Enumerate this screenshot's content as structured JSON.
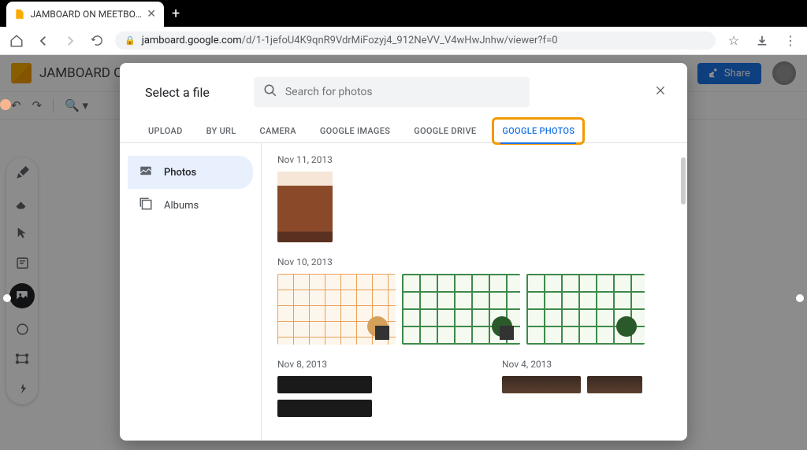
{
  "browser": {
    "tab_title": "JAMBOARD ON MEETBOARD",
    "url_domain": "jamboard.google.com",
    "url_path": "/d/1-1jefoU4K9qnR9VdrMiFozyj4_912NeVV_V4wHwJnhw/viewer?f=0"
  },
  "app": {
    "title": "JAMBOARD O",
    "share_label": "Share"
  },
  "modal": {
    "title": "Select a file",
    "search_placeholder": "Search for photos",
    "tabs": {
      "upload": "UPLOAD",
      "byurl": "BY URL",
      "camera": "CAMERA",
      "gimages": "GOOGLE IMAGES",
      "gdrive": "GOOGLE DRIVE",
      "gphotos": "GOOGLE PHOTOS"
    },
    "side": {
      "photos": "Photos",
      "albums": "Albums"
    },
    "groups": {
      "d1": "Nov 11, 2013",
      "d2": "Nov 10, 2013",
      "d3": "Nov 8, 2013",
      "d4": "Nov 4, 2013"
    }
  }
}
